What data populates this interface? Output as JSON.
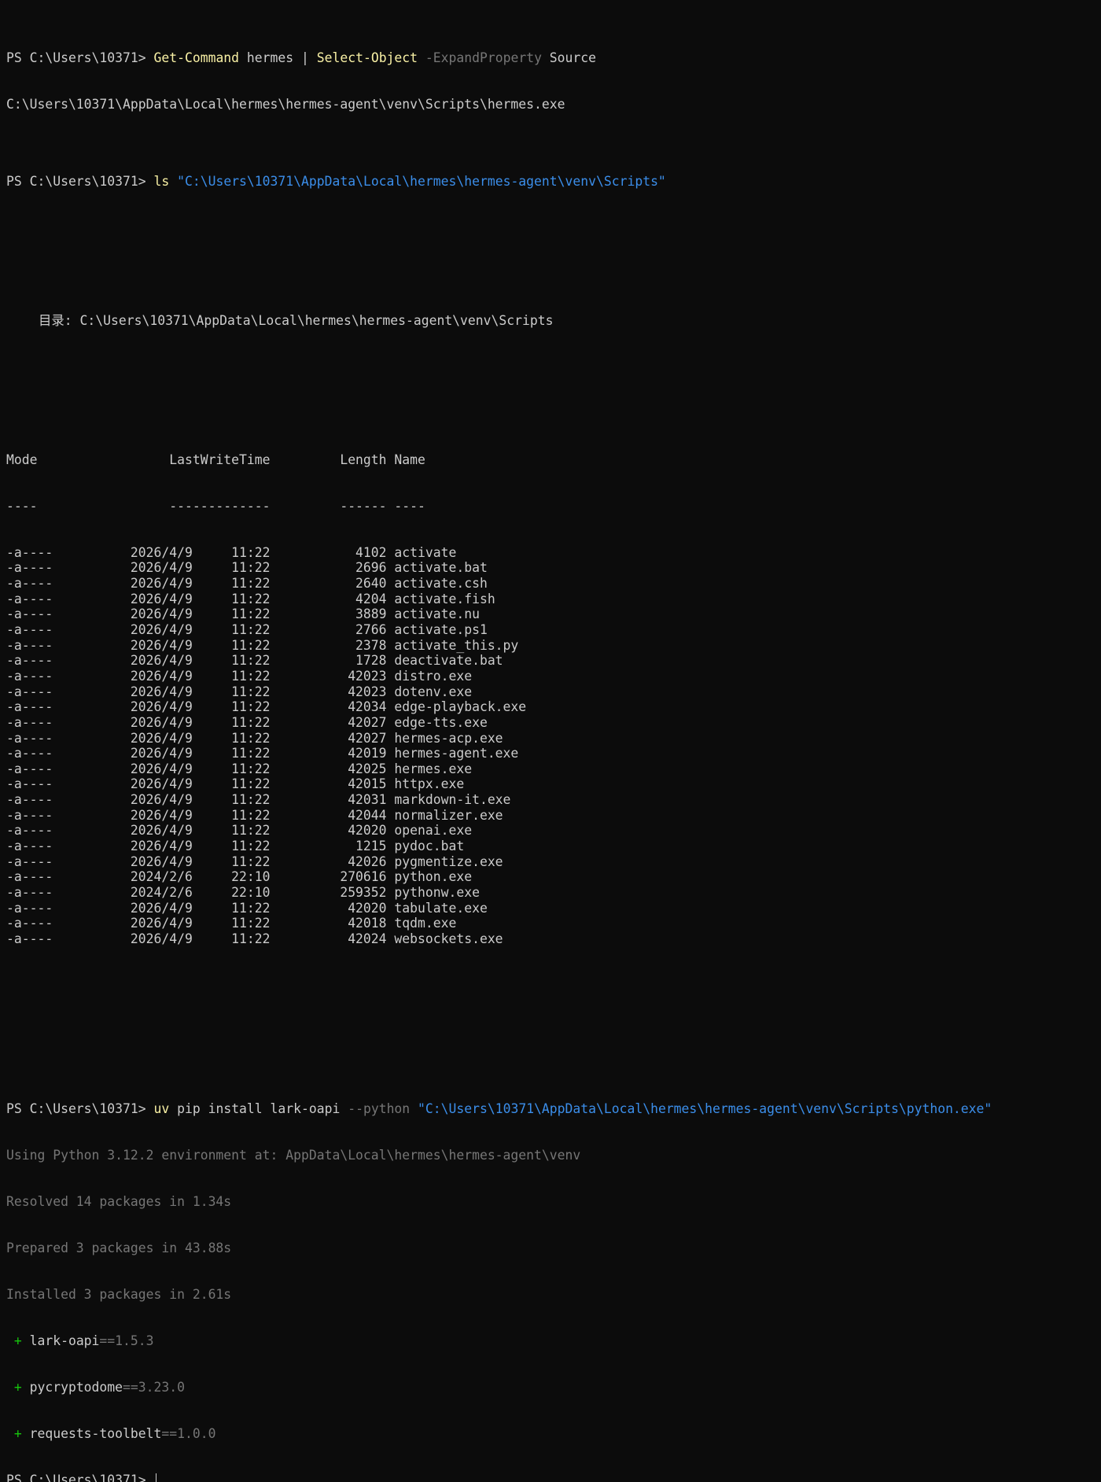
{
  "colors": {
    "background": "#0c0c0c",
    "foreground": "#cccccc",
    "command": "#f9f1a5",
    "parameter": "#767676",
    "string": "#3b8eea",
    "success_plus": "#16c60c"
  },
  "cmd1": {
    "prompt": "PS C:\\Users\\10371> ",
    "command": "Get-Command",
    "arg": " hermes | ",
    "command2": "Select-Object",
    "param": " -ExpandProperty",
    "arg2": " Source"
  },
  "cmd1_output": "C:\\Users\\10371\\AppData\\Local\\hermes\\hermes-agent\\venv\\Scripts\\hermes.exe",
  "cmd2": {
    "prompt": "PS C:\\Users\\10371> ",
    "command": "ls",
    "string": " \"C:\\Users\\10371\\AppData\\Local\\hermes\\hermes-agent\\venv\\Scripts\""
  },
  "directory_header": "目录: C:\\Users\\10371\\AppData\\Local\\hermes\\hermes-agent\\venv\\Scripts",
  "table_header": "Mode                 LastWriteTime         Length Name",
  "table_rule": "----                 -------------         ------ ----",
  "files": [
    "-a----          2026/4/9     11:22           4102 activate",
    "-a----          2026/4/9     11:22           2696 activate.bat",
    "-a----          2026/4/9     11:22           2640 activate.csh",
    "-a----          2026/4/9     11:22           4204 activate.fish",
    "-a----          2026/4/9     11:22           3889 activate.nu",
    "-a----          2026/4/9     11:22           2766 activate.ps1",
    "-a----          2026/4/9     11:22           2378 activate_this.py",
    "-a----          2026/4/9     11:22           1728 deactivate.bat",
    "-a----          2026/4/9     11:22          42023 distro.exe",
    "-a----          2026/4/9     11:22          42023 dotenv.exe",
    "-a----          2026/4/9     11:22          42034 edge-playback.exe",
    "-a----          2026/4/9     11:22          42027 edge-tts.exe",
    "-a----          2026/4/9     11:22          42027 hermes-acp.exe",
    "-a----          2026/4/9     11:22          42019 hermes-agent.exe",
    "-a----          2026/4/9     11:22          42025 hermes.exe",
    "-a----          2026/4/9     11:22          42015 httpx.exe",
    "-a----          2026/4/9     11:22          42031 markdown-it.exe",
    "-a----          2026/4/9     11:22          42044 normalizer.exe",
    "-a----          2026/4/9     11:22          42020 openai.exe",
    "-a----          2026/4/9     11:22           1215 pydoc.bat",
    "-a----          2026/4/9     11:22          42026 pygmentize.exe",
    "-a----          2024/2/6     22:10         270616 python.exe",
    "-a----          2024/2/6     22:10         259352 pythonw.exe",
    "-a----          2026/4/9     11:22          42020 tabulate.exe",
    "-a----          2026/4/9     11:22          42018 tqdm.exe",
    "-a----          2026/4/9     11:22          42024 websockets.exe"
  ],
  "cmd3": {
    "prompt": "PS C:\\Users\\10371> ",
    "command": "uv",
    "arg": " pip install lark-oapi",
    "param": " --python",
    "string": " \"C:\\Users\\10371\\AppData\\Local\\hermes\\hermes-agent\\venv\\Scripts\\python.exe\""
  },
  "uv_output": [
    "Using Python 3.12.2 environment at: AppData\\Local\\hermes\\hermes-agent\\venv",
    "Resolved 14 packages in 1.34s",
    "Prepared 3 packages in 43.88s",
    "Installed 3 packages in 2.61s"
  ],
  "installed": [
    {
      "plus": " + ",
      "name": "lark-oapi",
      "version": "==1.5.3"
    },
    {
      "plus": " + ",
      "name": "pycryptodome",
      "version": "==3.23.0"
    },
    {
      "plus": " + ",
      "name": "requests-toolbelt",
      "version": "==1.0.0"
    }
  ],
  "final_prompt": "PS C:\\Users\\10371> "
}
